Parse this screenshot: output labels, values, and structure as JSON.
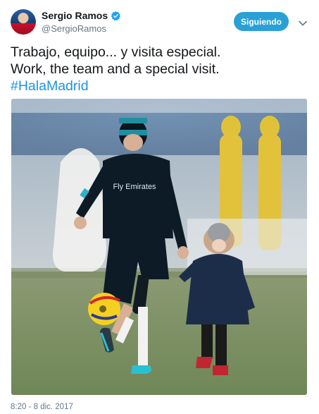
{
  "author": {
    "display_name": "Sergio Ramos",
    "handle": "@SergioRamos",
    "verified_icon": "verified-badge-icon"
  },
  "follow_button": {
    "label": "Siguiendo"
  },
  "menu_caret_icon": "chevron-down-icon",
  "tweet": {
    "line1": "Trabajo, equipo... y visita especial.",
    "line2": "Work, the team and a special visit.",
    "hashtag": "#HalaMadrid"
  },
  "media": {
    "shirt_sponsor": "Fly Emirates",
    "description_icon": "photo-media"
  },
  "timestamp": "8:20 - 8 dic. 2017",
  "colors": {
    "accent": "#1da1f2",
    "follow_bg": "#2aa0d6",
    "hashtag": "#1b95e0",
    "muted": "#657786",
    "text": "#14171a"
  }
}
